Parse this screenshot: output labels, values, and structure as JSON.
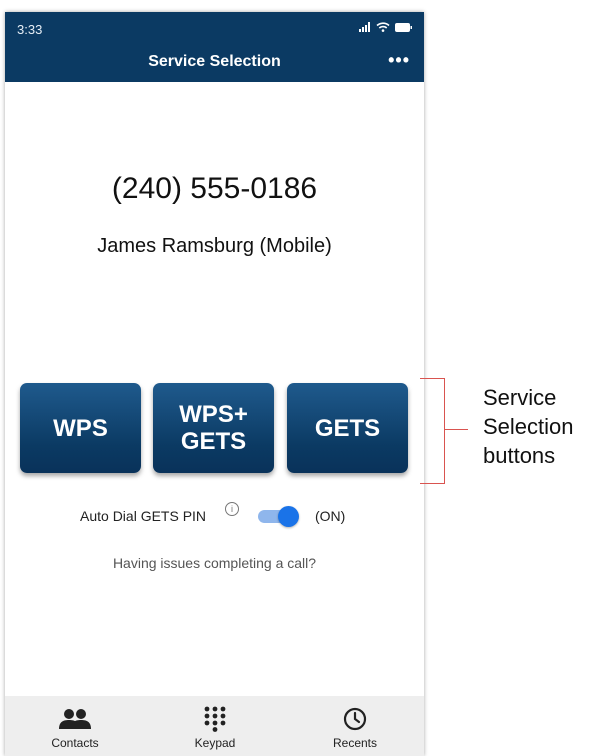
{
  "status_bar": {
    "time": "3:33"
  },
  "header": {
    "title": "Service Selection",
    "more_icon": "•••"
  },
  "contact": {
    "number": "(240) 555-0186",
    "name": "James Ramsburg (Mobile)"
  },
  "services": {
    "wps": "WPS",
    "wps_gets_line1": "WPS+",
    "wps_gets_line2": "GETS",
    "gets": "GETS"
  },
  "auto_dial": {
    "label": "Auto Dial GETS PIN",
    "info": "i",
    "state": "(ON)",
    "enabled": true
  },
  "help_link": "Having issues completing a call?",
  "tabs": [
    {
      "label": "Contacts",
      "icon": "people-icon"
    },
    {
      "label": "Keypad",
      "icon": "keypad-icon"
    },
    {
      "label": "Recents",
      "icon": "clock-icon"
    }
  ],
  "annotation": {
    "line1": "Service",
    "line2": "Selection",
    "line3": "buttons",
    "color": "#d9534f"
  },
  "colors": {
    "brand": "#0b3a63",
    "toggle": "#1a73e8"
  }
}
